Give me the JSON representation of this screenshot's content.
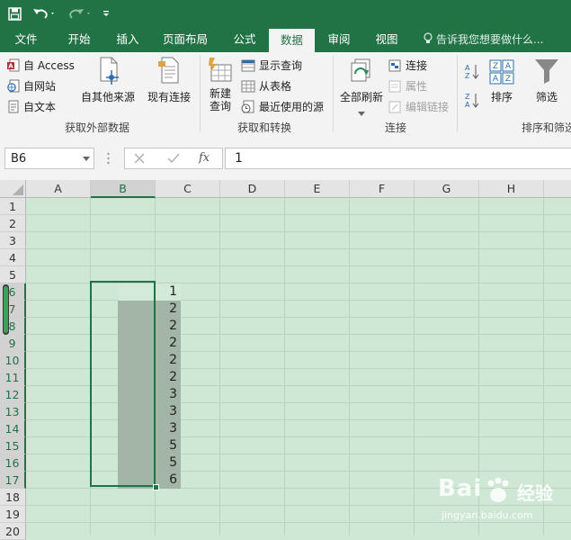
{
  "tabs": [
    {
      "label": "文件",
      "active": false
    },
    {
      "label": "开始",
      "active": false
    },
    {
      "label": "插入",
      "active": false
    },
    {
      "label": "页面布局",
      "active": false
    },
    {
      "label": "公式",
      "active": false
    },
    {
      "label": "数据",
      "active": true
    },
    {
      "label": "审阅",
      "active": false
    },
    {
      "label": "视图",
      "active": false
    }
  ],
  "tell_me": "告诉我您想要做什么...",
  "ribbon": {
    "get_external": {
      "access": "自 Access",
      "web": "自网站",
      "text": "自文本",
      "other": "自其他来源",
      "existing": "现有连接",
      "label": "获取外部数据"
    },
    "transform": {
      "new_query_1": "新建",
      "new_query_2": "查询",
      "show_queries": "显示查询",
      "from_table": "从表格",
      "recent_sources": "最近使用的源",
      "label": "获取和转换"
    },
    "connections": {
      "refresh_all": "全部刷新",
      "connections": "连接",
      "properties": "属性",
      "edit_links": "编辑链接",
      "label": "连接"
    },
    "sort_filter": {
      "sort": "排序",
      "filter": "筛选",
      "label": "排序和筛选"
    }
  },
  "formula_bar": {
    "name_box": "B6",
    "value": "1"
  },
  "columns": [
    "A",
    "B",
    "C",
    "D",
    "E",
    "F",
    "G",
    "H"
  ],
  "rows": [
    "1",
    "2",
    "3",
    "4",
    "5",
    "6",
    "7",
    "8",
    "9",
    "10",
    "11",
    "12",
    "13",
    "14",
    "15",
    "16",
    "17",
    "18",
    "19",
    "20"
  ],
  "column_b_values": [
    "1",
    "2",
    "2",
    "2",
    "2",
    "2",
    "3",
    "3",
    "3",
    "5",
    "5",
    "6"
  ],
  "watermark": {
    "brand": "Bai",
    "brand2": "经验",
    "sub": "jingyan.baidu.com"
  },
  "colors": {
    "excel_green": "#217346",
    "sheet_bg": "#cfe8d5",
    "selection": "#a3b5a6"
  }
}
